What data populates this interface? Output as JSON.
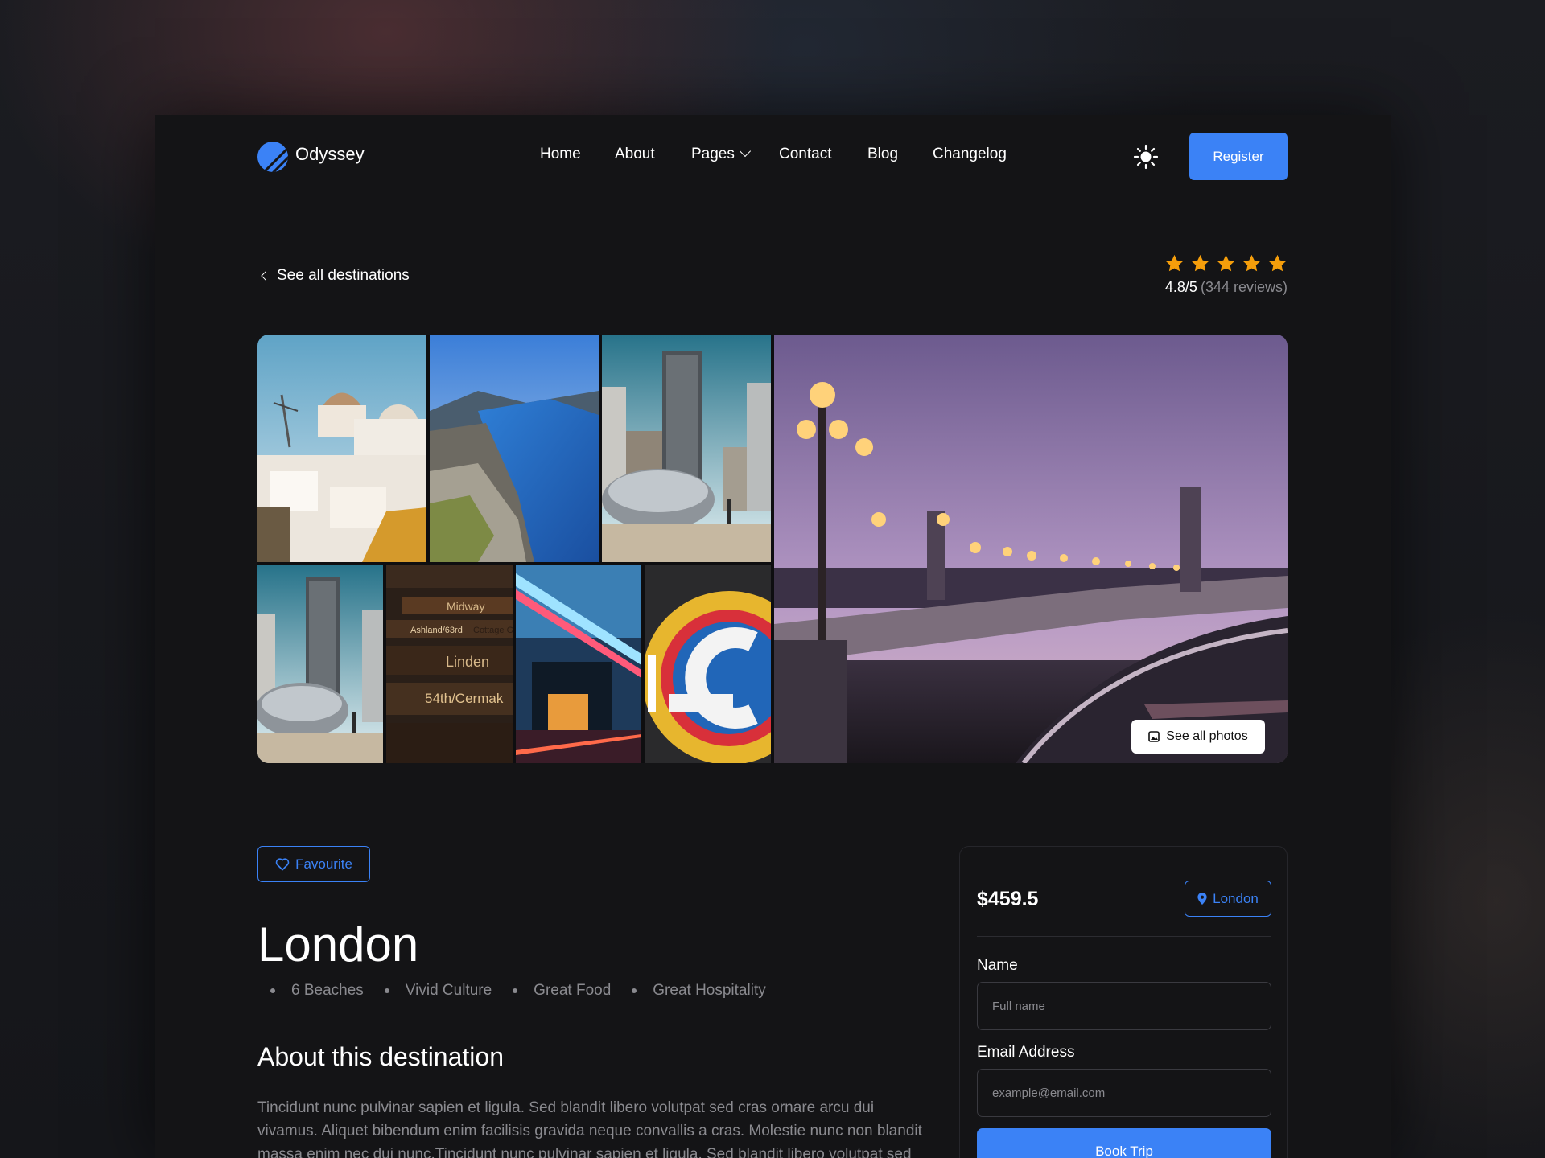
{
  "brand": {
    "name": "Odyssey",
    "accent": "#3b82f6"
  },
  "nav": {
    "items": [
      "Home",
      "About",
      "Pages",
      "Contact",
      "Blog",
      "Changelog"
    ],
    "theme_toggle_icon": "sun-icon",
    "register_label": "Register"
  },
  "back_link": {
    "label": "See all destinations"
  },
  "rating": {
    "score": "4.8/5",
    "reviews": "(344 reviews)",
    "stars": 5,
    "star_color": "#f59e0b"
  },
  "gallery": {
    "see_all_label": "See all photos",
    "signs": [
      "Midway",
      "Ashland/63rd",
      "Cottage G",
      "Linden",
      "54th/Cermak"
    ]
  },
  "destination": {
    "favourite_label": "Favourite",
    "title": "London",
    "features": [
      "6 Beaches",
      "Vivid Culture",
      "Great Food",
      "Great Hospitality"
    ],
    "about_heading": "About this destination",
    "about_text": "Tincidunt nunc pulvinar sapien et ligula. Sed blandit libero volutpat sed cras ornare arcu dui vivamus. Aliquet bibendum enim facilisis gravida neque convallis a cras. Molestie nunc non blandit massa enim nec dui nunc.Tincidunt nunc pulvinar sapien et ligula. Sed blandit libero volutpat sed cras"
  },
  "booking": {
    "price": "$459.5",
    "location": "London",
    "name_label": "Name",
    "name_placeholder": "Full name",
    "email_label": "Email Address",
    "email_placeholder": "example@email.com",
    "button_label": "Book Trip"
  }
}
